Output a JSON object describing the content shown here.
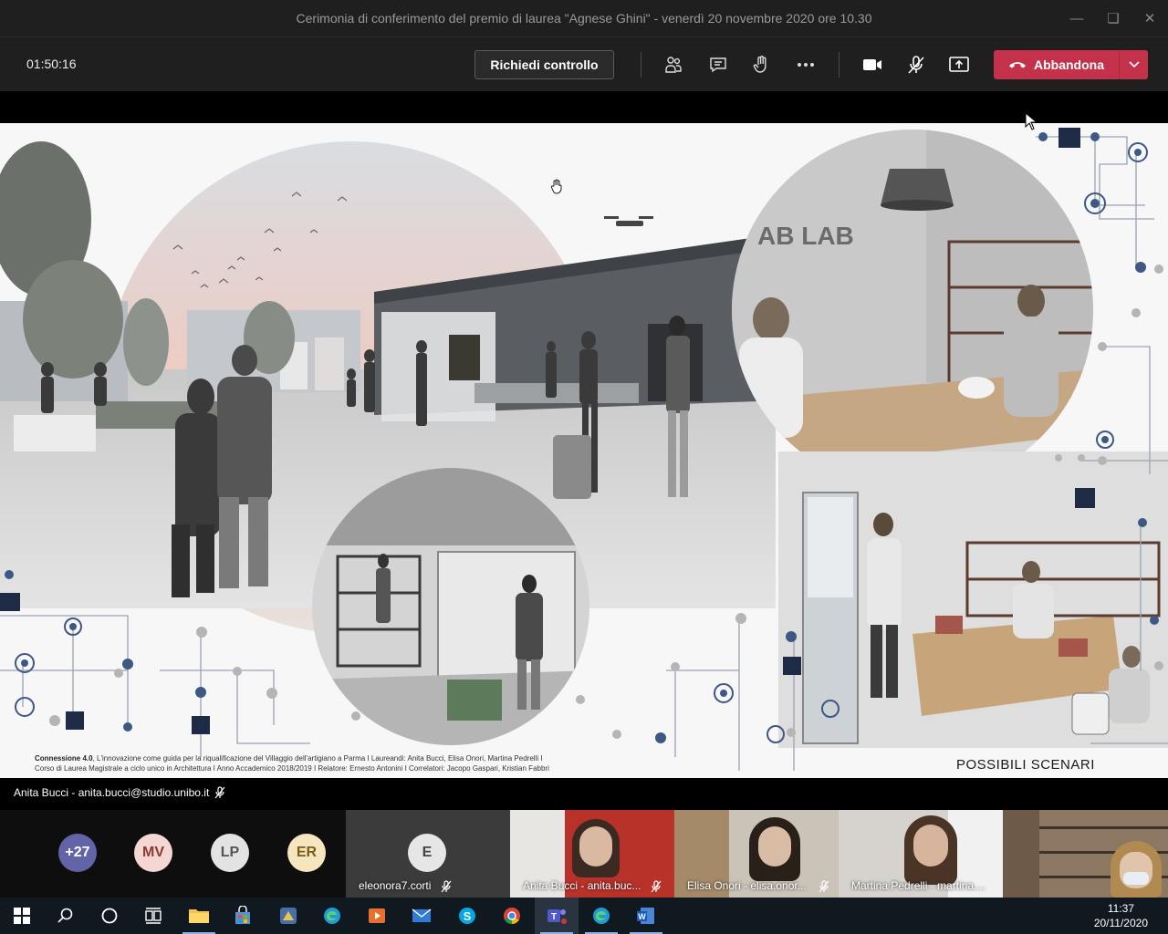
{
  "window": {
    "title": "Cerimonia di conferimento del premio di laurea \"Agnese Ghini\" - venerdì 20 novembre 2020 ore 10.30"
  },
  "toolbar": {
    "timer": "01:50:16",
    "request_control_label": "Richiedi controllo",
    "leave_label": "Abbandona",
    "leave_color": "#c4314b"
  },
  "slide": {
    "sign_text": "AB LAB",
    "credits_title": "Connessione 4.0",
    "credits_line1": ", L'innovazione come guida per la riqualificazione del Villaggio dell'artigiano a Parma I Laureandi: Anita Bucci, Elisa Onori, Martina Pedrelli I",
    "credits_line2": "Corso di Laurea Magistrale a ciclo unico in Architettura I Anno Accademico 2018/2019 I Relatore: Ernesto Antonini I Correlatori: Jacopo Gaspari, Kristian Fabbri",
    "caption": "POSSIBILI SCENARI"
  },
  "presenter": {
    "label": "Anita Bucci - anita.bucci@studio.unibo.it"
  },
  "participants": {
    "overflow": "+27",
    "avatars": [
      {
        "initials": "MV",
        "bg": "#f4d6d2",
        "fg": "#8a3b34"
      },
      {
        "initials": "LP",
        "bg": "#e3e3e3",
        "fg": "#555555"
      },
      {
        "initials": "ER",
        "bg": "#f6e6bf",
        "fg": "#7a5c1a"
      }
    ],
    "tiles": [
      {
        "initial": "E",
        "name": "eleonora7.corti"
      },
      {
        "name": "Anita Bucci - anita.buc..."
      },
      {
        "name": "Elisa Onori - elisa.onor..."
      },
      {
        "name": "Martina Pedrelli - martina...."
      }
    ]
  },
  "taskbar": {
    "time": "11:37",
    "date": "20/11/2020"
  }
}
